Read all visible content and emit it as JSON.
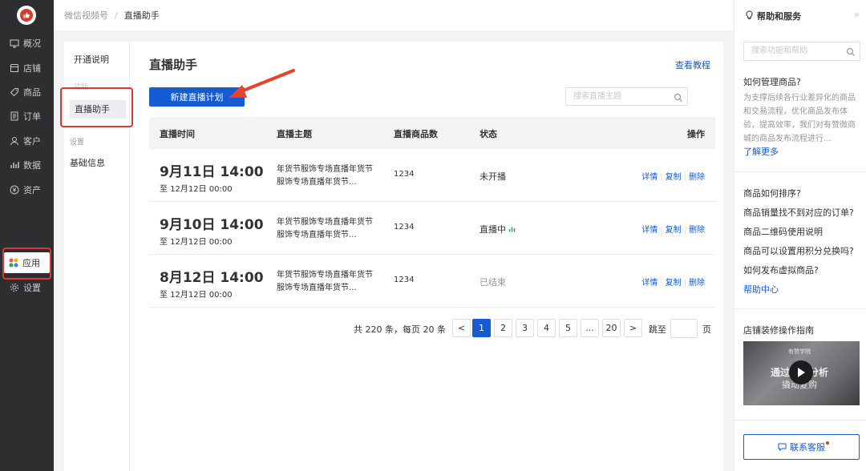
{
  "nav": {
    "items": [
      {
        "label": "概况",
        "icon": "monitor-icon"
      },
      {
        "label": "店铺",
        "icon": "store-icon"
      },
      {
        "label": "商品",
        "icon": "tag-icon"
      },
      {
        "label": "订单",
        "icon": "order-icon"
      },
      {
        "label": "客户",
        "icon": "user-icon"
      },
      {
        "label": "数据",
        "icon": "bar-chart-icon"
      },
      {
        "label": "资产",
        "icon": "yuan-icon"
      },
      {
        "label": "应用",
        "icon": "apps-icon"
      },
      {
        "label": "设置",
        "icon": "gear-icon"
      }
    ],
    "active_index": 7
  },
  "breadcrumb": {
    "parent": "微信视频号",
    "separator": "/",
    "current": "直播助手"
  },
  "subnav": {
    "intro": "开通说明",
    "group1": "功能",
    "current": "直播助手",
    "group2": "设置",
    "base": "基础信息"
  },
  "main": {
    "title": "直播助手",
    "help_link": "查看教程",
    "new_button": "新建直播计划",
    "search_placeholder": "搜索直播主题"
  },
  "table": {
    "headers": [
      "直播时间",
      "直播主题",
      "直播商品数",
      "状态",
      "操作"
    ],
    "rows": [
      {
        "time": "9月11日 14:00",
        "to": "至 12月12日 00:00",
        "theme": "年货节服饰专场直播年货节服饰专场直播年货节...",
        "count": "1234",
        "status": "未开播",
        "ops": [
          "详情",
          "复制",
          "删除"
        ]
      },
      {
        "time": "9月10日 14:00",
        "to": "至 12月12日 00:00",
        "theme": "年货节服饰专场直播年货节服饰专场直播年货节...",
        "count": "1234",
        "status": "直播中",
        "ops": [
          "详情",
          "复制",
          "删除"
        ]
      },
      {
        "time": "8月12日 14:00",
        "to": "至 12月12日 00:00",
        "theme": "年货节服饰专场直播年货节服饰专场直播年货节...",
        "count": "1234",
        "status": "已结束",
        "ops": [
          "详情",
          "复制",
          "删除"
        ]
      }
    ]
  },
  "pager": {
    "total": "共 220 条，每页 20 条",
    "prev": "<",
    "pages": [
      "1",
      "2",
      "3",
      "4",
      "5",
      "...",
      "20"
    ],
    "current": "1",
    "next": ">",
    "jump_label": "跳至",
    "page_unit": "页"
  },
  "help_panel": {
    "title": "帮助和服务",
    "collapse": "»",
    "search_placeholder": "搜索功能和帮助",
    "q1": "如何管理商品?",
    "desc": "为支撑后续各行业差异化的商品和交易流程，优化商品发布体验，提高效率，我们对有赞微商城的商品发布流程进行...",
    "more": "了解更多",
    "faq": [
      "商品如何排序?",
      "商品销量找不到对应的订单?",
      "商品二维码使用说明",
      "商品可以设置用积分兑换吗?",
      "如何发布虚拟商品?"
    ],
    "center": "帮助中心",
    "guide": "店铺装修操作指南",
    "video_brand": "有赞学院",
    "video_title": "通过数据分析",
    "video_sub": "撬动复购",
    "cs_button": "联系客服"
  },
  "colors": {
    "primary": "#155bd4",
    "nav_bg": "#2e2e30",
    "highlight": "#d93a2b",
    "live_green": "#2da641"
  }
}
